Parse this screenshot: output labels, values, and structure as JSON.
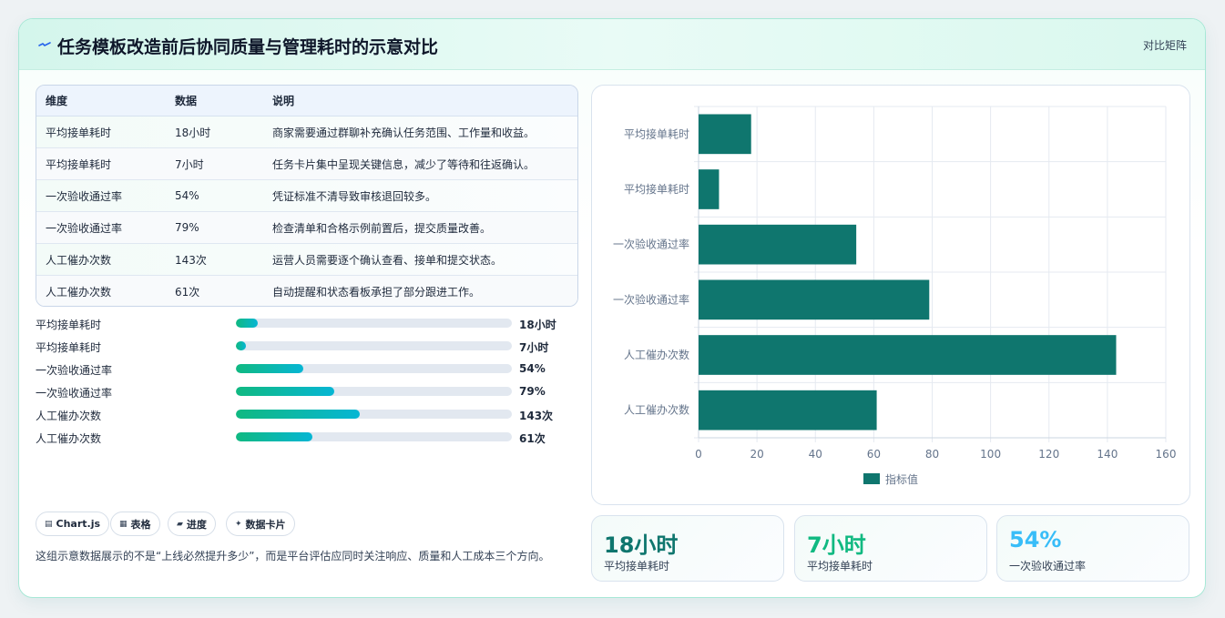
{
  "header": {
    "title": "任务模板改造前后协同质量与管理耗时的示意对比",
    "tag": "对比矩阵"
  },
  "table": {
    "headers": [
      "维度",
      "数据",
      "说明"
    ],
    "rows": [
      {
        "dim": "平均接单耗时",
        "value": "18小时",
        "note": "商家需要通过群聊补充确认任务范围、工作量和收益。"
      },
      {
        "dim": "平均接单耗时",
        "value": "7小时",
        "note": "任务卡片集中呈现关键信息，减少了等待和往返确认。"
      },
      {
        "dim": "一次验收通过率",
        "value": "54%",
        "note": "凭证标准不清导致审核退回较多。"
      },
      {
        "dim": "一次验收通过率",
        "value": "79%",
        "note": "检查清单和合格示例前置后，提交质量改善。"
      },
      {
        "dim": "人工催办次数",
        "value": "143次",
        "note": "运营人员需要逐个确认查看、接单和提交状态。"
      },
      {
        "dim": "人工催办次数",
        "value": "61次",
        "note": "自动提醒和状态看板承担了部分跟进工作。"
      }
    ]
  },
  "progress": [
    {
      "label": "平均接单耗时",
      "value_text": "18小时",
      "fraction": 0.08
    },
    {
      "label": "平均接单耗时",
      "value_text": "7小时",
      "fraction": 0.035
    },
    {
      "label": "一次验收通过率",
      "value_text": "54%",
      "fraction": 0.245
    },
    {
      "label": "一次验收通过率",
      "value_text": "79%",
      "fraction": 0.358
    },
    {
      "label": "人工催办次数",
      "value_text": "143次",
      "fraction": 0.45
    },
    {
      "label": "人工催办次数",
      "value_text": "61次",
      "fraction": 0.278
    }
  ],
  "chips": [
    {
      "icon": "chart-icon",
      "label": "Chart.js"
    },
    {
      "icon": "table-icon",
      "label": "表格"
    },
    {
      "icon": "progress-icon",
      "label": "进度"
    },
    {
      "icon": "sparkle-icon",
      "label": "数据卡片"
    }
  ],
  "description": "这组示意数据展示的不是“上线必然提升多少”，而是平台评估应同时关注响应、质量和人工成本三个方向。",
  "kpis": [
    {
      "value": "18小时",
      "label": "平均接单耗时",
      "color": "#0f766e"
    },
    {
      "value": "7小时",
      "label": "平均接单耗时",
      "color": "#10b981"
    },
    {
      "value": "54%",
      "label": "一次验收通过率",
      "color": "#38bdf8"
    }
  ],
  "chart_data": {
    "type": "bar",
    "orientation": "horizontal",
    "categories": [
      "平均接单耗时",
      "平均接单耗时",
      "一次验收通过率",
      "一次验收通过率",
      "人工催办次数",
      "人工催办次数"
    ],
    "series": [
      {
        "name": "指标值",
        "values": [
          18,
          7,
          54,
          79,
          143,
          61
        ],
        "color": "#0f766e"
      }
    ],
    "xlim": [
      0,
      160
    ],
    "xticks": [
      0,
      20,
      40,
      60,
      80,
      100,
      120,
      140,
      160
    ],
    "grid": true,
    "legend": "bottom"
  }
}
